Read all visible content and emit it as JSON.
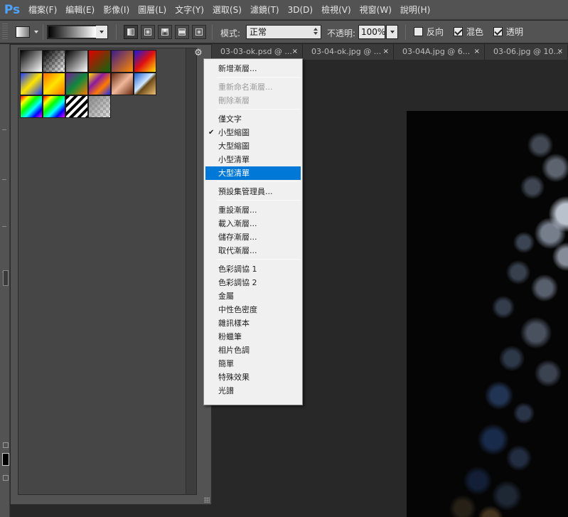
{
  "app": {
    "logo": "Ps"
  },
  "menubar": {
    "items": [
      "檔案(F)",
      "編輯(E)",
      "影像(I)",
      "圖層(L)",
      "文字(Y)",
      "選取(S)",
      "濾鏡(T)",
      "3D(D)",
      "檢視(V)",
      "視窗(W)",
      "說明(H)"
    ]
  },
  "options": {
    "mode_label": "模式:",
    "mode_value": "正常",
    "opacity_label": "不透明:",
    "opacity_value": "100%",
    "reverse_label": "反向",
    "reverse_checked": false,
    "dither_label": "混色",
    "dither_checked": true,
    "transparency_label": "透明",
    "transparency_checked": true,
    "gradient_types": [
      "linear",
      "radial",
      "angle",
      "reflected",
      "diamond"
    ],
    "active_gradient_type": "linear"
  },
  "gradient_panel": {
    "gear_icon": "gear-icon",
    "swatches": [
      {
        "name": "foreground-to-background",
        "css": "linear-gradient(135deg,#000 0%,#fff 100%)"
      },
      {
        "name": "foreground-to-transparent",
        "css": "linear-gradient(135deg,#000 0%,rgba(0,0,0,0) 100%)"
      },
      {
        "name": "black-white",
        "css": "linear-gradient(135deg,#000 0%,#fff 100%)"
      },
      {
        "name": "red-green",
        "css": "linear-gradient(135deg,#e00000 0%,#0c6a0c 100%)"
      },
      {
        "name": "violet-orange",
        "css": "linear-gradient(135deg,#3a1a8a 0%,#ff8a00 100%)"
      },
      {
        "name": "blue-red-yellow",
        "css": "linear-gradient(135deg,#1818e0 0%,#e01010 50%,#ffe000 100%)"
      },
      {
        "name": "blue-yellow-blue",
        "css": "linear-gradient(135deg,#1a3aff 0%,#ffe400 50%,#1a3aff 100%)"
      },
      {
        "name": "orange-yellow-orange",
        "css": "linear-gradient(135deg,#ff6a00 0%,#ffe400 50%,#ff6a00 100%)"
      },
      {
        "name": "violet-green-orange",
        "css": "linear-gradient(135deg,#7a1a9a 0%,#0e8a3a 50%,#ff7a00 100%)"
      },
      {
        "name": "yellow-violet-orange-blue",
        "css": "linear-gradient(135deg,#ffe400 0%,#8a1aa0 35%,#ff7a00 65%,#1a2aff 100%)"
      },
      {
        "name": "copper",
        "css": "linear-gradient(135deg,#6a2a12 0%,#f0b89a 50%,#6a2a12 100%)"
      },
      {
        "name": "chrome",
        "css": "linear-gradient(135deg,#1a5ad0 0%,#cfe8ff 45%,#6a4a1a 55%,#f0c070 100%)"
      },
      {
        "name": "spectrum",
        "css": "linear-gradient(135deg,#ff0000 0%,#ffff00 20%,#00ff00 40%,#00ffff 60%,#0000ff 80%,#ff00ff 100%)"
      },
      {
        "name": "transparent-rainbow",
        "css": "linear-gradient(135deg,#ff0000 0%,#ffff00 20%,#00ff00 40%,#00ffff 60%,#0000ff 80%,#ff00ff 100%)"
      },
      {
        "name": "transparent-stripes",
        "css": "repeating-linear-gradient(135deg,#000 0 4px,#fff 4px 8px)"
      },
      {
        "name": "neutral-density",
        "css": "linear-gradient(135deg,#888 0%,rgba(160,160,160,0.3) 100%)"
      }
    ]
  },
  "tabs": [
    {
      "label": "03-03-ok.psd @ ..."
    },
    {
      "label": "03-04-ok.jpg @ ..."
    },
    {
      "label": "03-04A.jpg @ 6..."
    },
    {
      "label": "03-06.jpg @ 10..."
    }
  ],
  "gradient_menu": {
    "items": [
      {
        "label": "新增漸層...",
        "disabled": false
      },
      {
        "label": "重新命名漸層...",
        "disabled": true
      },
      {
        "label": "刪除漸層",
        "disabled": true
      },
      {
        "label": "僅文字",
        "disabled": false
      },
      {
        "label": "小型縮圖",
        "disabled": false,
        "checked": true
      },
      {
        "label": "大型縮圖",
        "disabled": false
      },
      {
        "label": "小型清單",
        "disabled": false
      },
      {
        "label": "大型清單",
        "disabled": false,
        "highlighted": true
      },
      {
        "label": "預設集管理員...",
        "disabled": false
      },
      {
        "label": "重設漸層...",
        "disabled": false
      },
      {
        "label": "載入漸層...",
        "disabled": false
      },
      {
        "label": "儲存漸層...",
        "disabled": false
      },
      {
        "label": "取代漸層...",
        "disabled": false
      },
      {
        "label": "色彩調協 1",
        "disabled": false
      },
      {
        "label": "色彩調協 2",
        "disabled": false
      },
      {
        "label": "金屬",
        "disabled": false
      },
      {
        "label": "中性色密度",
        "disabled": false
      },
      {
        "label": "雜訊樣本",
        "disabled": false
      },
      {
        "label": "粉蠟筆",
        "disabled": false
      },
      {
        "label": "相片色調",
        "disabled": false
      },
      {
        "label": "簡單",
        "disabled": false
      },
      {
        "label": "特殊效果",
        "disabled": false
      },
      {
        "label": "光譜",
        "disabled": false
      }
    ]
  },
  "colors": {
    "ui_dark": "#535353",
    "menu_highlight": "#0078d7",
    "canvas_bg": "#050505",
    "ps_logo_blue": "#4ea2ff"
  }
}
